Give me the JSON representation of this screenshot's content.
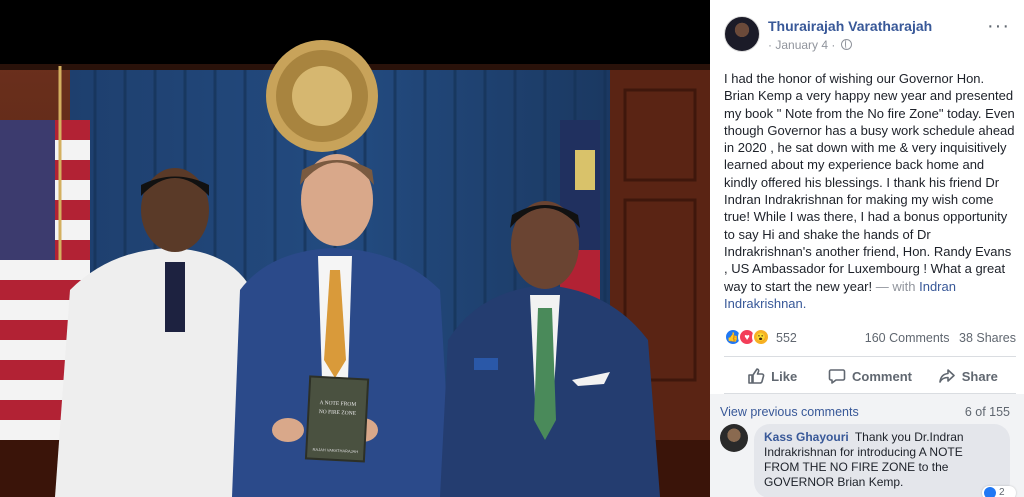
{
  "post": {
    "author": "Thurairajah Varatharajah",
    "date": "January 4",
    "separator": "·",
    "more_icon": "···",
    "text": "I had the honor of wishing our Governor Hon. Brian Kemp a very happy new year and presented my book \" Note from the No fire Zone\" today. Even though Governor has a busy work schedule ahead in 2020 , he sat down with me & very inquisitively learned about my experience back home and kindly offered his blessings. I thank his friend Dr Indran Indrakrishnan for making my wish come true! While I was there, I had a bonus opportunity to say Hi and shake the hands of Dr Indrakrishnan's another friend, Hon. Randy Evans , US Ambassador for Luxembourg ! What a great way to start the new year!",
    "with_label": "— with",
    "tagged": "Indran Indrakrishnan."
  },
  "reactions": {
    "count": "552",
    "comments": "160 Comments",
    "shares": "38 Shares",
    "icons": [
      "like-icon",
      "love-icon",
      "wow-icon"
    ],
    "colors": {
      "like": "#2078f4",
      "love": "#f33e58",
      "wow": "#f7b125"
    }
  },
  "actions": {
    "like": "Like",
    "comment": "Comment",
    "share": "Share"
  },
  "comments": {
    "view_previous": "View previous comments",
    "count": "6 of 155",
    "items": [
      {
        "name": "Kass Ghayouri",
        "text": "Thank you Dr.Indran Indrakrishnan for introducing A NOTE FROM THE NO FIRE ZONE to the GOVERNOR Brian Kemp.",
        "reactions": "2"
      }
    ]
  },
  "photo": {
    "book_title": "A NOTE FROM THE NO FIRE ZONE",
    "book_line1": "A NOTE FROM",
    "book_line2": "NO FIRE ZONE",
    "book_author": "RAJAH VARATHARAJAH"
  },
  "colors": {
    "link": "#385898",
    "secondary": "#606770",
    "background": "#ffffff",
    "comment_bg": "#f2f3f5"
  }
}
